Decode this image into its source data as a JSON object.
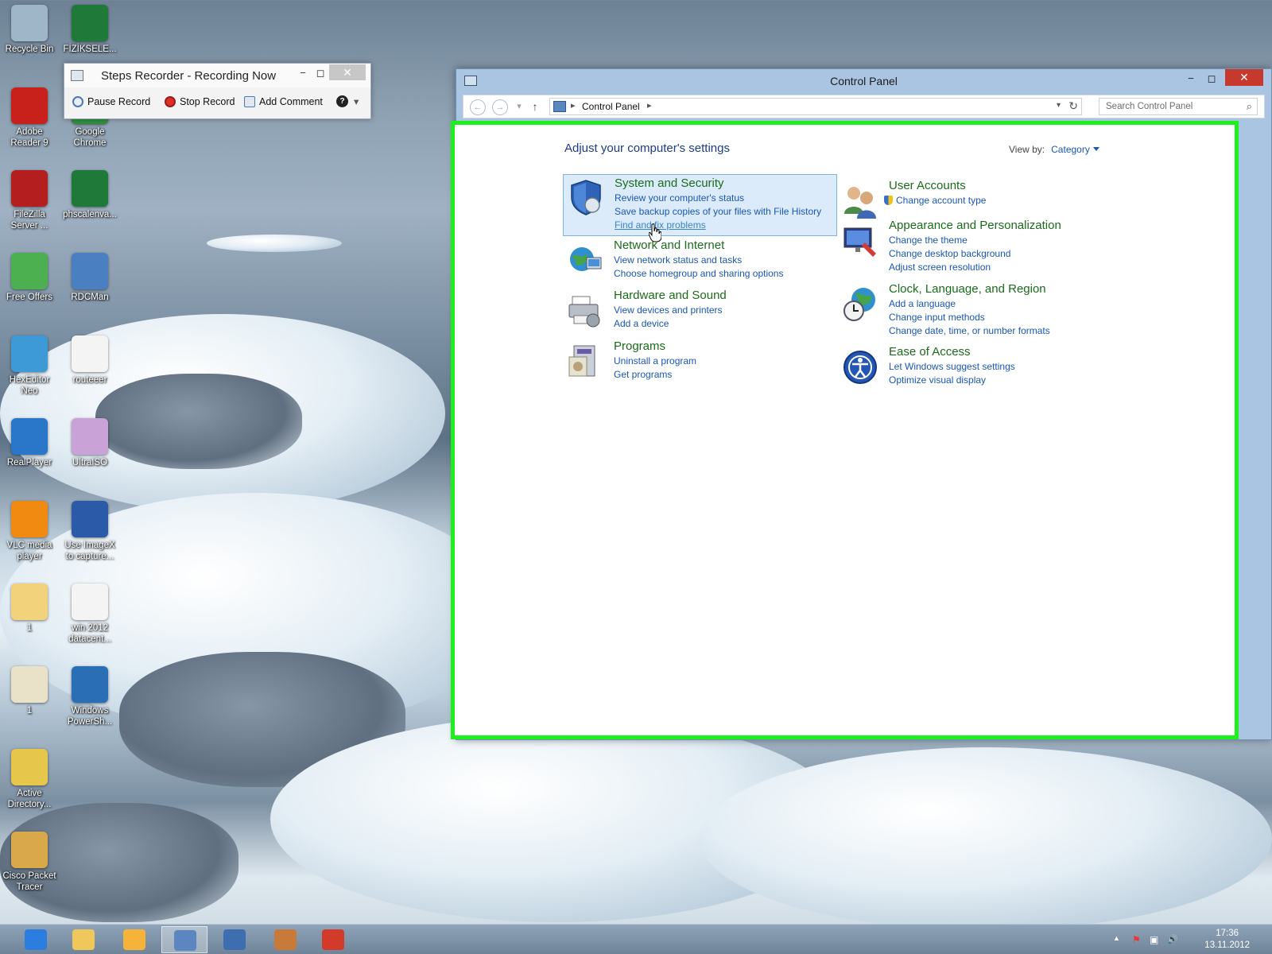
{
  "desktop": {
    "icons": [
      {
        "label": "Recycle Bin",
        "icon": "recycle-bin-icon",
        "color": "#9fb6c9"
      },
      {
        "label": "FİZİKSELE...",
        "icon": "excel-file-icon",
        "color": "#1f7a3a"
      },
      {
        "label": "Adobe Reader 9",
        "icon": "adobe-reader-icon",
        "color": "#c8211b"
      },
      {
        "label": "Google Chrome",
        "icon": "chrome-icon",
        "color": "#2f8f3d"
      },
      {
        "label": "FileZilla Server ...",
        "icon": "filezilla-icon",
        "color": "#b51e1e"
      },
      {
        "label": "phscalenva...",
        "icon": "excel-file-icon",
        "color": "#1f7a3a"
      },
      {
        "label": "Free Offers",
        "icon": "gift-icon",
        "color": "#4caf50"
      },
      {
        "label": "RDCMan",
        "icon": "rdcman-icon",
        "color": "#4a7fc1"
      },
      {
        "label": "HexEditor Neo",
        "icon": "hexeditor-icon",
        "color": "#3d9ad6"
      },
      {
        "label": "routeeer",
        "icon": "text-file-icon",
        "color": "#f4f4f4"
      },
      {
        "label": "RealPlayer",
        "icon": "realplayer-icon",
        "color": "#2a77c9"
      },
      {
        "label": "UltraISO",
        "icon": "disc-icon",
        "color": "#c9a2d8"
      },
      {
        "label": "VLC media player",
        "icon": "vlc-icon",
        "color": "#f08a10"
      },
      {
        "label": "Use ImageX to capture...",
        "icon": "screen-file-icon",
        "color": "#2a5aa8"
      },
      {
        "label": "1",
        "icon": "folder-icon",
        "color": "#f2d27a"
      },
      {
        "label": "win 2012 datacent...",
        "icon": "text-file-icon",
        "color": "#f4f4f4"
      },
      {
        "label": "1",
        "icon": "image-file-icon",
        "color": "#e9e2c8"
      },
      {
        "label": "Windows PowerSh...",
        "icon": "powershell-icon",
        "color": "#2a6fb5"
      },
      {
        "label": "Active Directory...",
        "icon": "active-directory-icon",
        "color": "#e6c64b"
      },
      {
        "label": "Cisco Packet Tracer",
        "icon": "packet-tracer-icon",
        "color": "#d8a84a"
      }
    ]
  },
  "steps_recorder": {
    "title": "Steps Recorder - Recording Now",
    "minimize": "−",
    "restore": "◻",
    "close": "✕",
    "pause_label": "Pause Record",
    "stop_label": "Stop Record",
    "comment_label": "Add Comment",
    "help": "?",
    "menu_arrow": "▾"
  },
  "control_panel": {
    "title": "Control Panel",
    "minimize": "−",
    "maximize": "◻",
    "close": "✕",
    "nav": {
      "back": "←",
      "forward": "→",
      "recent": "▾",
      "up": "↑",
      "sep": "▸",
      "breadcrumb": "Control Panel",
      "dropdown": "▾",
      "refresh": "↻"
    },
    "search_placeholder": "Search Control Panel",
    "search_glyph": "⌕",
    "heading": "Adjust your computer's settings",
    "view_by_label": "View by:",
    "view_by_value": "Category",
    "categories": [
      {
        "name": "System and Security",
        "icon": "shield-icon",
        "links": [
          "Review your computer's status",
          "Save backup copies of your files with File History",
          "Find and fix problems"
        ]
      },
      {
        "name": "Network and Internet",
        "icon": "globe-network-icon",
        "links": [
          "View network status and tasks",
          "Choose homegroup and sharing options"
        ]
      },
      {
        "name": "Hardware and Sound",
        "icon": "printer-icon",
        "links": [
          "View devices and printers",
          "Add a device"
        ]
      },
      {
        "name": "Programs",
        "icon": "programs-icon",
        "links": [
          "Uninstall a program",
          "Get programs"
        ]
      },
      {
        "name": "User Accounts",
        "icon": "users-icon",
        "links": [
          "Change account type"
        ]
      },
      {
        "name": "Appearance and Personalization",
        "icon": "appearance-icon",
        "links": [
          "Change the theme",
          "Change desktop background",
          "Adjust screen resolution"
        ]
      },
      {
        "name": "Clock, Language, and Region",
        "icon": "clock-globe-icon",
        "links": [
          "Add a language",
          "Change input methods",
          "Change date, time, or number formats"
        ]
      },
      {
        "name": "Ease of Access",
        "icon": "ease-of-access-icon",
        "links": [
          "Let Windows suggest settings",
          "Optimize visual display"
        ]
      }
    ]
  },
  "taskbar": {
    "items": [
      {
        "icon": "internet-explorer-icon",
        "color": "#2b7de0"
      },
      {
        "icon": "file-explorer-icon",
        "color": "#f0c75a"
      },
      {
        "icon": "outlook-icon",
        "color": "#f5b33a"
      },
      {
        "icon": "control-panel-icon",
        "color": "#5c86bf"
      },
      {
        "icon": "remote-desktop-icon",
        "color": "#3d6fb0"
      },
      {
        "icon": "app-icon",
        "color": "#c77a3a"
      },
      {
        "icon": "steps-recorder-icon",
        "color": "#d23a2a"
      }
    ],
    "tray": {
      "up_arrow": "▲",
      "flag": "⚑",
      "network": "▣",
      "volume": "🔊"
    },
    "time": "17:36",
    "date": "13.11.2012"
  }
}
